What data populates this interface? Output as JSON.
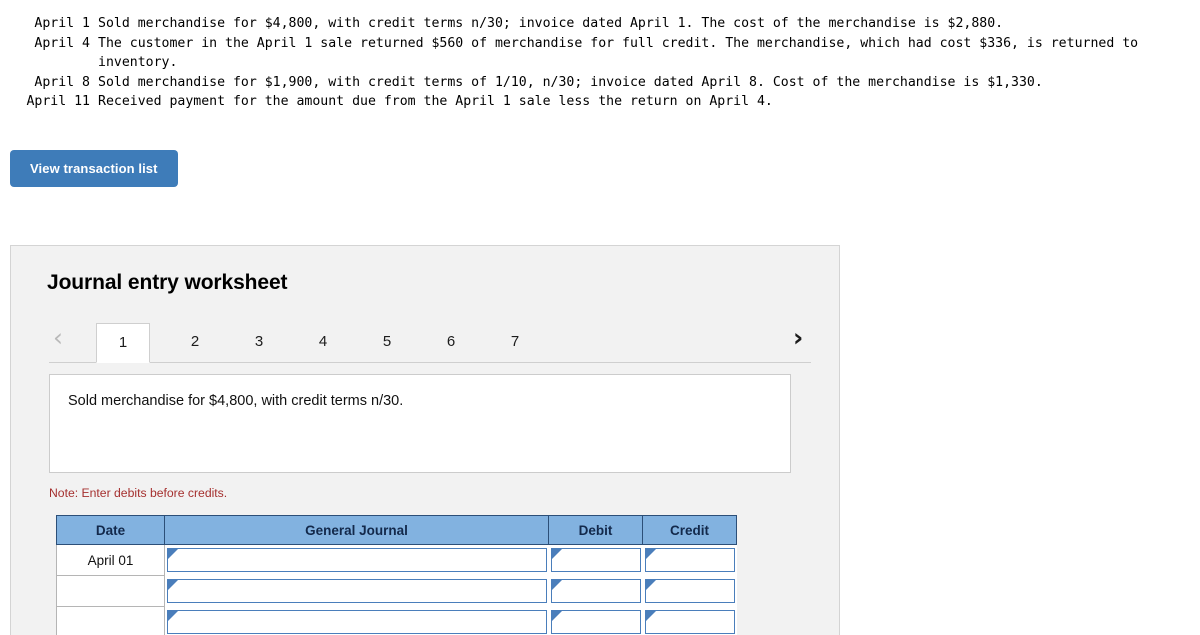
{
  "transactions": [
    {
      "date": "April 1",
      "description": "Sold merchandise for $4,800, with credit terms n/30; invoice dated April 1. The cost of the merchandise is $2,880."
    },
    {
      "date": "April 4",
      "description": "The customer in the April 1 sale returned $560 of merchandise for full credit. The merchandise, which had cost $336, is returned to inventory."
    },
    {
      "date": "April 8",
      "description": "Sold merchandise for $1,900, with credit terms of 1/10, n/30; invoice dated April 8. Cost of the merchandise is $1,330."
    },
    {
      "date": "April 11",
      "description": "Received payment for the amount due from the April 1 sale less the return on April 4."
    }
  ],
  "toolbar": {
    "view_transaction_list_label": "View transaction list"
  },
  "worksheet": {
    "title": "Journal entry worksheet",
    "prev_icon": "‹",
    "next_icon": "›",
    "tabs": [
      {
        "label": "1",
        "active": true
      },
      {
        "label": "2",
        "active": false
      },
      {
        "label": "3",
        "active": false
      },
      {
        "label": "4",
        "active": false
      },
      {
        "label": "5",
        "active": false
      },
      {
        "label": "6",
        "active": false
      },
      {
        "label": "7",
        "active": false
      }
    ],
    "prompt": "Sold merchandise for $4,800, with credit terms n/30.",
    "note": "Note: Enter debits before credits.",
    "table": {
      "headers": [
        "Date",
        "General Journal",
        "Debit",
        "Credit"
      ],
      "rows": [
        {
          "date": "April 01",
          "general_journal": "",
          "debit": "",
          "credit": ""
        },
        {
          "date": "",
          "general_journal": "",
          "debit": "",
          "credit": ""
        },
        {
          "date": "",
          "general_journal": "",
          "debit": "",
          "credit": ""
        }
      ]
    }
  },
  "colors": {
    "button_blue": "#3e7cb9",
    "table_header_blue": "#82b2e0",
    "cell_border_blue": "#4a7ebb",
    "note_red": "#a5302f",
    "panel_bg": "#f2f2f2"
  }
}
